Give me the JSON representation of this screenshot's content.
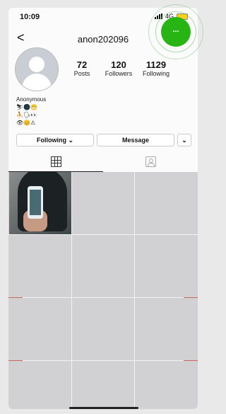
{
  "status": {
    "time": "10:09",
    "network": "4G"
  },
  "nav": {
    "back": "<",
    "username": "anon202096",
    "more": "..."
  },
  "stats": [
    {
      "value": "72",
      "label": "Posts"
    },
    {
      "value": "120",
      "label": "Followers"
    },
    {
      "value": "1129",
      "label": "Following"
    }
  ],
  "bio": {
    "name": "Anonymous",
    "line1": "⛷🌑😬",
    "line2": "⛹🗣👀",
    "line3": "👁😊⚠"
  },
  "buttons": {
    "following": "Following ⌄",
    "message": "Message",
    "dropdown": "⌄"
  },
  "colors": {
    "accent": "#27b514"
  },
  "icons": {
    "back": "chevron-left-icon",
    "more": "ellipsis-icon",
    "grid": "grid-icon",
    "tagged": "tagged-photos-icon"
  }
}
